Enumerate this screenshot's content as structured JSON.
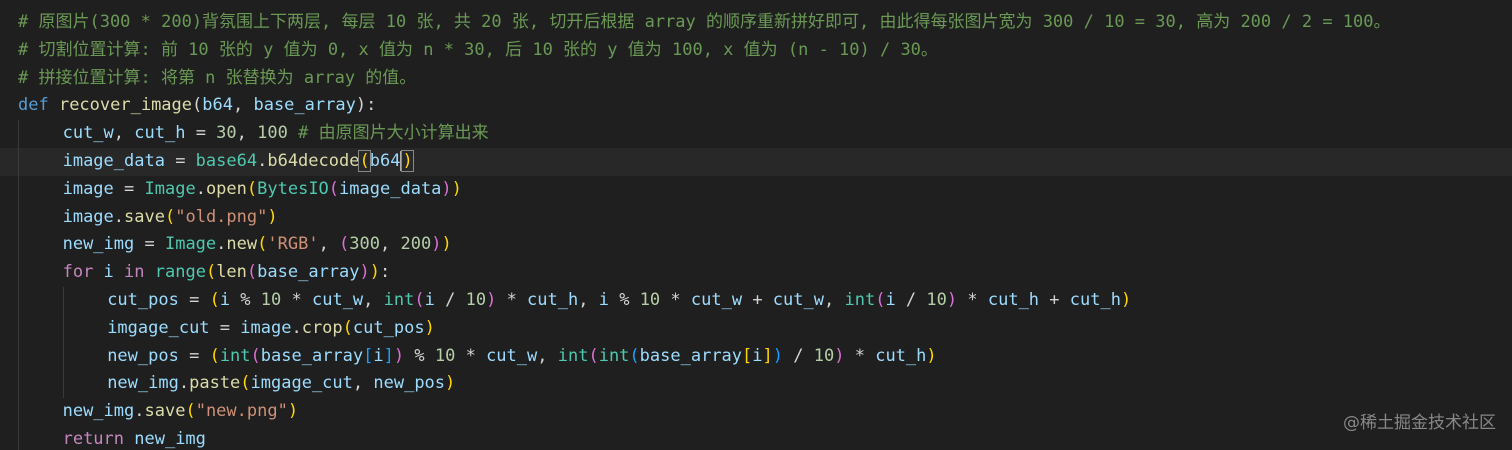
{
  "editor": {
    "language": "python",
    "background": "#1f1f1f",
    "cursor_line": 6,
    "lines": [
      {
        "indent": 0,
        "tokens": [
          {
            "t": "comment",
            "v": "# 原图片(300 * 200)背氛围上下两层, 每层 10 张, 共 20 张, 切开后根据 array 的顺序重新拼好即可, 由此得每张图片宽为 300 / 10 = 30, 高为 200 / 2 = 100。"
          }
        ]
      },
      {
        "indent": 0,
        "tokens": [
          {
            "t": "comment",
            "v": "# 切割位置计算: 前 10 张的 y 值为 0, x 值为 n * 30, 后 10 张的 y 值为 100, x 值为 (n - 10) / 30。"
          }
        ]
      },
      {
        "indent": 0,
        "tokens": [
          {
            "t": "comment",
            "v": "# 拼接位置计算: 将第 n 张替换为 array 的值。"
          }
        ]
      },
      {
        "indent": 0,
        "tokens": [
          {
            "t": "keyword",
            "v": "def "
          },
          {
            "t": "function",
            "v": "recover_image"
          },
          {
            "t": "plain",
            "v": "("
          },
          {
            "t": "param",
            "v": "b64"
          },
          {
            "t": "plain",
            "v": ", "
          },
          {
            "t": "param",
            "v": "base_array"
          },
          {
            "t": "plain",
            "v": "):"
          }
        ]
      },
      {
        "indent": 1,
        "tokens": [
          {
            "t": "variable",
            "v": "cut_w"
          },
          {
            "t": "plain",
            "v": ", "
          },
          {
            "t": "variable",
            "v": "cut_h"
          },
          {
            "t": "plain",
            "v": " = "
          },
          {
            "t": "number",
            "v": "30"
          },
          {
            "t": "plain",
            "v": ", "
          },
          {
            "t": "number",
            "v": "100"
          },
          {
            "t": "comment",
            "v": " # 由原图片大小计算出来"
          }
        ]
      },
      {
        "indent": 1,
        "tokens": [
          {
            "t": "variable",
            "v": "image_data"
          },
          {
            "t": "plain",
            "v": " = "
          },
          {
            "t": "class",
            "v": "base64"
          },
          {
            "t": "plain",
            "v": "."
          },
          {
            "t": "function",
            "v": "b64decode"
          },
          {
            "t": "bracket-match",
            "v": "("
          },
          {
            "t": "variable",
            "v": "b64"
          },
          {
            "t": "cursor",
            "v": ""
          },
          {
            "t": "bracket-match",
            "v": ")"
          }
        ]
      },
      {
        "indent": 1,
        "tokens": [
          {
            "t": "variable",
            "v": "image"
          },
          {
            "t": "plain",
            "v": " = "
          },
          {
            "t": "class",
            "v": "Image"
          },
          {
            "t": "plain",
            "v": "."
          },
          {
            "t": "function",
            "v": "open"
          },
          {
            "t": "bracket2",
            "v": "("
          },
          {
            "t": "class",
            "v": "BytesIO"
          },
          {
            "t": "bracket",
            "v": "("
          },
          {
            "t": "variable",
            "v": "image_data"
          },
          {
            "t": "bracket",
            "v": ")"
          },
          {
            "t": "bracket2",
            "v": ")"
          }
        ]
      },
      {
        "indent": 1,
        "tokens": [
          {
            "t": "variable",
            "v": "image"
          },
          {
            "t": "plain",
            "v": "."
          },
          {
            "t": "function",
            "v": "save"
          },
          {
            "t": "bracket2",
            "v": "("
          },
          {
            "t": "string",
            "v": "\"old.png\""
          },
          {
            "t": "bracket2",
            "v": ")"
          }
        ]
      },
      {
        "indent": 1,
        "tokens": [
          {
            "t": "variable",
            "v": "new_img"
          },
          {
            "t": "plain",
            "v": " = "
          },
          {
            "t": "class",
            "v": "Image"
          },
          {
            "t": "plain",
            "v": "."
          },
          {
            "t": "function",
            "v": "new"
          },
          {
            "t": "bracket2",
            "v": "("
          },
          {
            "t": "string",
            "v": "'RGB'"
          },
          {
            "t": "plain",
            "v": ", "
          },
          {
            "t": "bracket",
            "v": "("
          },
          {
            "t": "number",
            "v": "300"
          },
          {
            "t": "plain",
            "v": ", "
          },
          {
            "t": "number",
            "v": "200"
          },
          {
            "t": "bracket",
            "v": ")"
          },
          {
            "t": "bracket2",
            "v": ")"
          }
        ]
      },
      {
        "indent": 1,
        "tokens": [
          {
            "t": "control",
            "v": "for "
          },
          {
            "t": "variable",
            "v": "i"
          },
          {
            "t": "control",
            "v": " in "
          },
          {
            "t": "builtin",
            "v": "range"
          },
          {
            "t": "bracket2",
            "v": "("
          },
          {
            "t": "function",
            "v": "len"
          },
          {
            "t": "bracket",
            "v": "("
          },
          {
            "t": "variable",
            "v": "base_array"
          },
          {
            "t": "bracket",
            "v": ")"
          },
          {
            "t": "bracket2",
            "v": ")"
          },
          {
            "t": "plain",
            "v": ":"
          }
        ]
      },
      {
        "indent": 2,
        "tokens": [
          {
            "t": "variable",
            "v": "cut_pos"
          },
          {
            "t": "plain",
            "v": " = "
          },
          {
            "t": "bracket2",
            "v": "("
          },
          {
            "t": "variable",
            "v": "i"
          },
          {
            "t": "plain",
            "v": " % "
          },
          {
            "t": "number",
            "v": "10"
          },
          {
            "t": "plain",
            "v": " * "
          },
          {
            "t": "variable",
            "v": "cut_w"
          },
          {
            "t": "plain",
            "v": ", "
          },
          {
            "t": "builtin",
            "v": "int"
          },
          {
            "t": "bracket",
            "v": "("
          },
          {
            "t": "variable",
            "v": "i"
          },
          {
            "t": "plain",
            "v": " / "
          },
          {
            "t": "number",
            "v": "10"
          },
          {
            "t": "bracket",
            "v": ")"
          },
          {
            "t": "plain",
            "v": " * "
          },
          {
            "t": "variable",
            "v": "cut_h"
          },
          {
            "t": "plain",
            "v": ", "
          },
          {
            "t": "variable",
            "v": "i"
          },
          {
            "t": "plain",
            "v": " % "
          },
          {
            "t": "number",
            "v": "10"
          },
          {
            "t": "plain",
            "v": " * "
          },
          {
            "t": "variable",
            "v": "cut_w"
          },
          {
            "t": "plain",
            "v": " + "
          },
          {
            "t": "variable",
            "v": "cut_w"
          },
          {
            "t": "plain",
            "v": ", "
          },
          {
            "t": "builtin",
            "v": "int"
          },
          {
            "t": "bracket",
            "v": "("
          },
          {
            "t": "variable",
            "v": "i"
          },
          {
            "t": "plain",
            "v": " / "
          },
          {
            "t": "number",
            "v": "10"
          },
          {
            "t": "bracket",
            "v": ")"
          },
          {
            "t": "plain",
            "v": " * "
          },
          {
            "t": "variable",
            "v": "cut_h"
          },
          {
            "t": "plain",
            "v": " + "
          },
          {
            "t": "variable",
            "v": "cut_h"
          },
          {
            "t": "bracket2",
            "v": ")"
          }
        ]
      },
      {
        "indent": 2,
        "tokens": [
          {
            "t": "variable",
            "v": "imgage_cut"
          },
          {
            "t": "plain",
            "v": " = "
          },
          {
            "t": "variable",
            "v": "image"
          },
          {
            "t": "plain",
            "v": "."
          },
          {
            "t": "function",
            "v": "crop"
          },
          {
            "t": "bracket2",
            "v": "("
          },
          {
            "t": "variable",
            "v": "cut_pos"
          },
          {
            "t": "bracket2",
            "v": ")"
          }
        ]
      },
      {
        "indent": 2,
        "tokens": [
          {
            "t": "variable",
            "v": "new_pos"
          },
          {
            "t": "plain",
            "v": " = "
          },
          {
            "t": "bracket2",
            "v": "("
          },
          {
            "t": "builtin",
            "v": "int"
          },
          {
            "t": "bracket",
            "v": "("
          },
          {
            "t": "variable",
            "v": "base_array"
          },
          {
            "t": "bracket3",
            "v": "["
          },
          {
            "t": "variable",
            "v": "i"
          },
          {
            "t": "bracket3",
            "v": "]"
          },
          {
            "t": "bracket",
            "v": ")"
          },
          {
            "t": "plain",
            "v": " % "
          },
          {
            "t": "number",
            "v": "10"
          },
          {
            "t": "plain",
            "v": " * "
          },
          {
            "t": "variable",
            "v": "cut_w"
          },
          {
            "t": "plain",
            "v": ", "
          },
          {
            "t": "builtin",
            "v": "int"
          },
          {
            "t": "bracket",
            "v": "("
          },
          {
            "t": "builtin",
            "v": "int"
          },
          {
            "t": "bracket3",
            "v": "("
          },
          {
            "t": "variable",
            "v": "base_array"
          },
          {
            "t": "bracket2",
            "v": "["
          },
          {
            "t": "variable",
            "v": "i"
          },
          {
            "t": "bracket2",
            "v": "]"
          },
          {
            "t": "bracket3",
            "v": ")"
          },
          {
            "t": "plain",
            "v": " / "
          },
          {
            "t": "number",
            "v": "10"
          },
          {
            "t": "bracket",
            "v": ")"
          },
          {
            "t": "plain",
            "v": " * "
          },
          {
            "t": "variable",
            "v": "cut_h"
          },
          {
            "t": "bracket2",
            "v": ")"
          }
        ]
      },
      {
        "indent": 2,
        "tokens": [
          {
            "t": "variable",
            "v": "new_img"
          },
          {
            "t": "plain",
            "v": "."
          },
          {
            "t": "function",
            "v": "paste"
          },
          {
            "t": "bracket2",
            "v": "("
          },
          {
            "t": "variable",
            "v": "imgage_cut"
          },
          {
            "t": "plain",
            "v": ", "
          },
          {
            "t": "variable",
            "v": "new_pos"
          },
          {
            "t": "bracket2",
            "v": ")"
          }
        ]
      },
      {
        "indent": 1,
        "tokens": [
          {
            "t": "variable",
            "v": "new_img"
          },
          {
            "t": "plain",
            "v": "."
          },
          {
            "t": "function",
            "v": "save"
          },
          {
            "t": "bracket2",
            "v": "("
          },
          {
            "t": "string",
            "v": "\"new.png\""
          },
          {
            "t": "bracket2",
            "v": ")"
          }
        ]
      },
      {
        "indent": 1,
        "tokens": [
          {
            "t": "control",
            "v": "return "
          },
          {
            "t": "variable",
            "v": "new_img"
          }
        ]
      }
    ]
  },
  "watermark": {
    "text": "@稀土掘金技术社区"
  }
}
